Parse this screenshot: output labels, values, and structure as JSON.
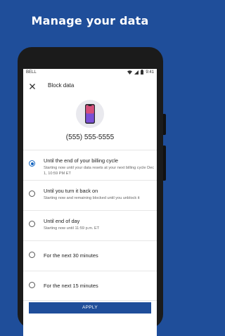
{
  "headline": "Manage your data",
  "status_bar": {
    "carrier": "BELL",
    "time": "9:41"
  },
  "app_bar": {
    "title": "Block data"
  },
  "phone_number": "(555) 555-5555",
  "options": [
    {
      "label": "Until the end of your billing cycle",
      "sub": "Starting now until your data resets at your next billing cycle Dec 1, 10:59 PM ET",
      "selected": true
    },
    {
      "label": "Until you turn it back on",
      "sub": "Starting now and remaining blocked until you unblock it",
      "selected": false
    },
    {
      "label": "Until end of day",
      "sub": "Starting now until 11:59 p.m. ET",
      "selected": false
    },
    {
      "label": "For the next 30 minutes",
      "sub": "",
      "selected": false
    },
    {
      "label": "For the next 15 minutes",
      "sub": "",
      "selected": false
    }
  ],
  "apply_label": "APPLY",
  "colors": {
    "brand": "#1f4e9a",
    "radio_selected": "#1565c0"
  }
}
